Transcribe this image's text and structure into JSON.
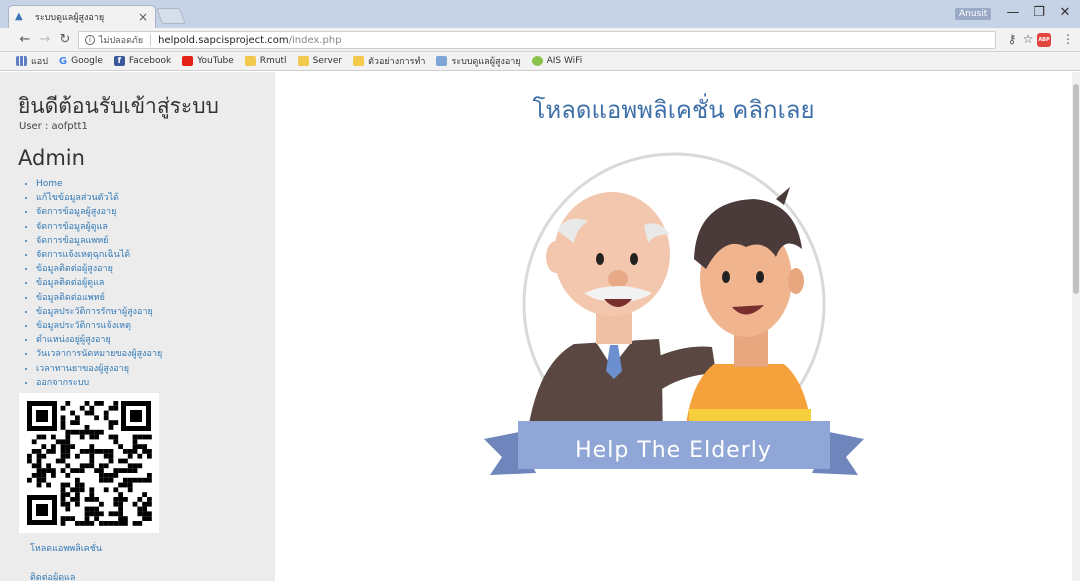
{
  "browser": {
    "tab_title": "ระบบดูแลผู้สูงอายุ",
    "profile_name": "Anusit",
    "not_secure_label": "ไม่ปลอดภัย",
    "url_host": "helpold.sapcisproject.com",
    "url_path": "/index.php",
    "bookmarks": [
      {
        "label": "แอป",
        "icon": "apps-icon"
      },
      {
        "label": "Google",
        "icon": "google-icon"
      },
      {
        "label": "Facebook",
        "icon": "facebook-icon"
      },
      {
        "label": "YouTube",
        "icon": "youtube-icon"
      },
      {
        "label": "Rmutl",
        "icon": "folder-icon"
      },
      {
        "label": "Server",
        "icon": "folder-icon"
      },
      {
        "label": "ตัวอย่างการทำ",
        "icon": "folder-icon"
      },
      {
        "label": "ระบบดูแลผู้สูงอายุ",
        "icon": "site-icon"
      },
      {
        "label": "AIS WiFi",
        "icon": "wifi-icon"
      }
    ]
  },
  "sidebar": {
    "welcome": "ยินดีต้อนรับเข้าสู่ระบบ",
    "user_line": "User : aofptt1",
    "role": "Admin",
    "menu": [
      "Home",
      "แก้ไขข้อมูลส่วนตัวได้",
      "จัดการข้อมูลผู้สูงอายุ",
      "จัดการข้อมูลผู้ดูแล",
      "จัดการข้อมูลแพทย์",
      "จัดการแจ้งเหตุฉุกเฉินได้",
      "ข้อมูลติดต่อผู้สูงอายุ",
      "ข้อมูลติดต่อผู้ดูแล",
      "ข้อมูลติดต่อแพทย์",
      "ข้อมูลประวัติการรักษาผู้สูงอายุ",
      "ข้อมูลประวัติการแจ้งเหตุ",
      "ตำแหน่งอยู่ผู้สูงอายุ",
      "วันเวลาการนัดหมายของผู้สูงอายุ",
      "เวลาทานยาของผู้สูงอายุ",
      "ออกจากระบบ"
    ],
    "download_link": "โหลดแอพพลิเคชั่น",
    "contact_link": "ติดต่อผู้ดูแล"
  },
  "main": {
    "headline": "โหลดแอพพลิเคชั่น คลิกเลย",
    "banner_text": "Help The Elderly"
  },
  "colors": {
    "link": "#337ab7",
    "headline": "#3d6fa8",
    "sidebar_bg": "#ececec",
    "banner": "#8fa6d6"
  }
}
